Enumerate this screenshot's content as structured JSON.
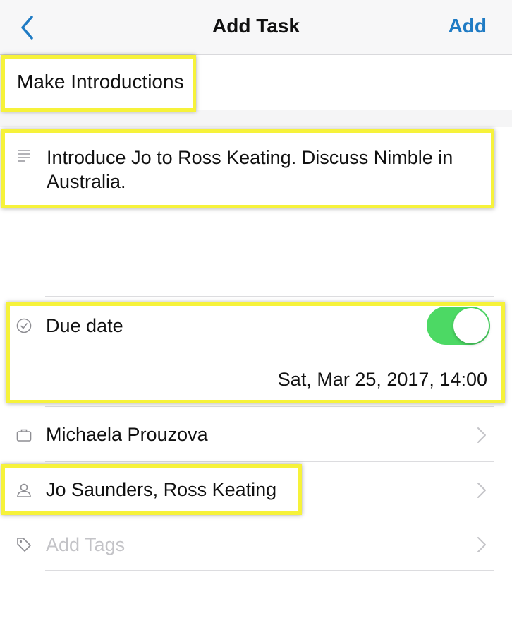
{
  "header": {
    "title": "Add Task",
    "add_label": "Add",
    "back_icon": "chevron-left-icon"
  },
  "task": {
    "name": "Make Introductions",
    "notes": "Introduce Jo to Ross Keating. Discuss Nimble in Australia."
  },
  "due_date": {
    "label": "Due date",
    "enabled": true,
    "value": "Sat, Mar 25, 2017, 14:00",
    "icon": "clock-icon"
  },
  "related": {
    "company": "Michaela Prouzova",
    "company_icon": "briefcase-icon",
    "contacts": "Jo Saunders, Ross Keating",
    "contacts_icon": "person-icon",
    "tags_placeholder": "Add Tags",
    "tags_icon": "tag-icon"
  },
  "colors": {
    "accent": "#1f7bc4",
    "toggle_on": "#4cd964",
    "highlight": "#f6f23a"
  }
}
